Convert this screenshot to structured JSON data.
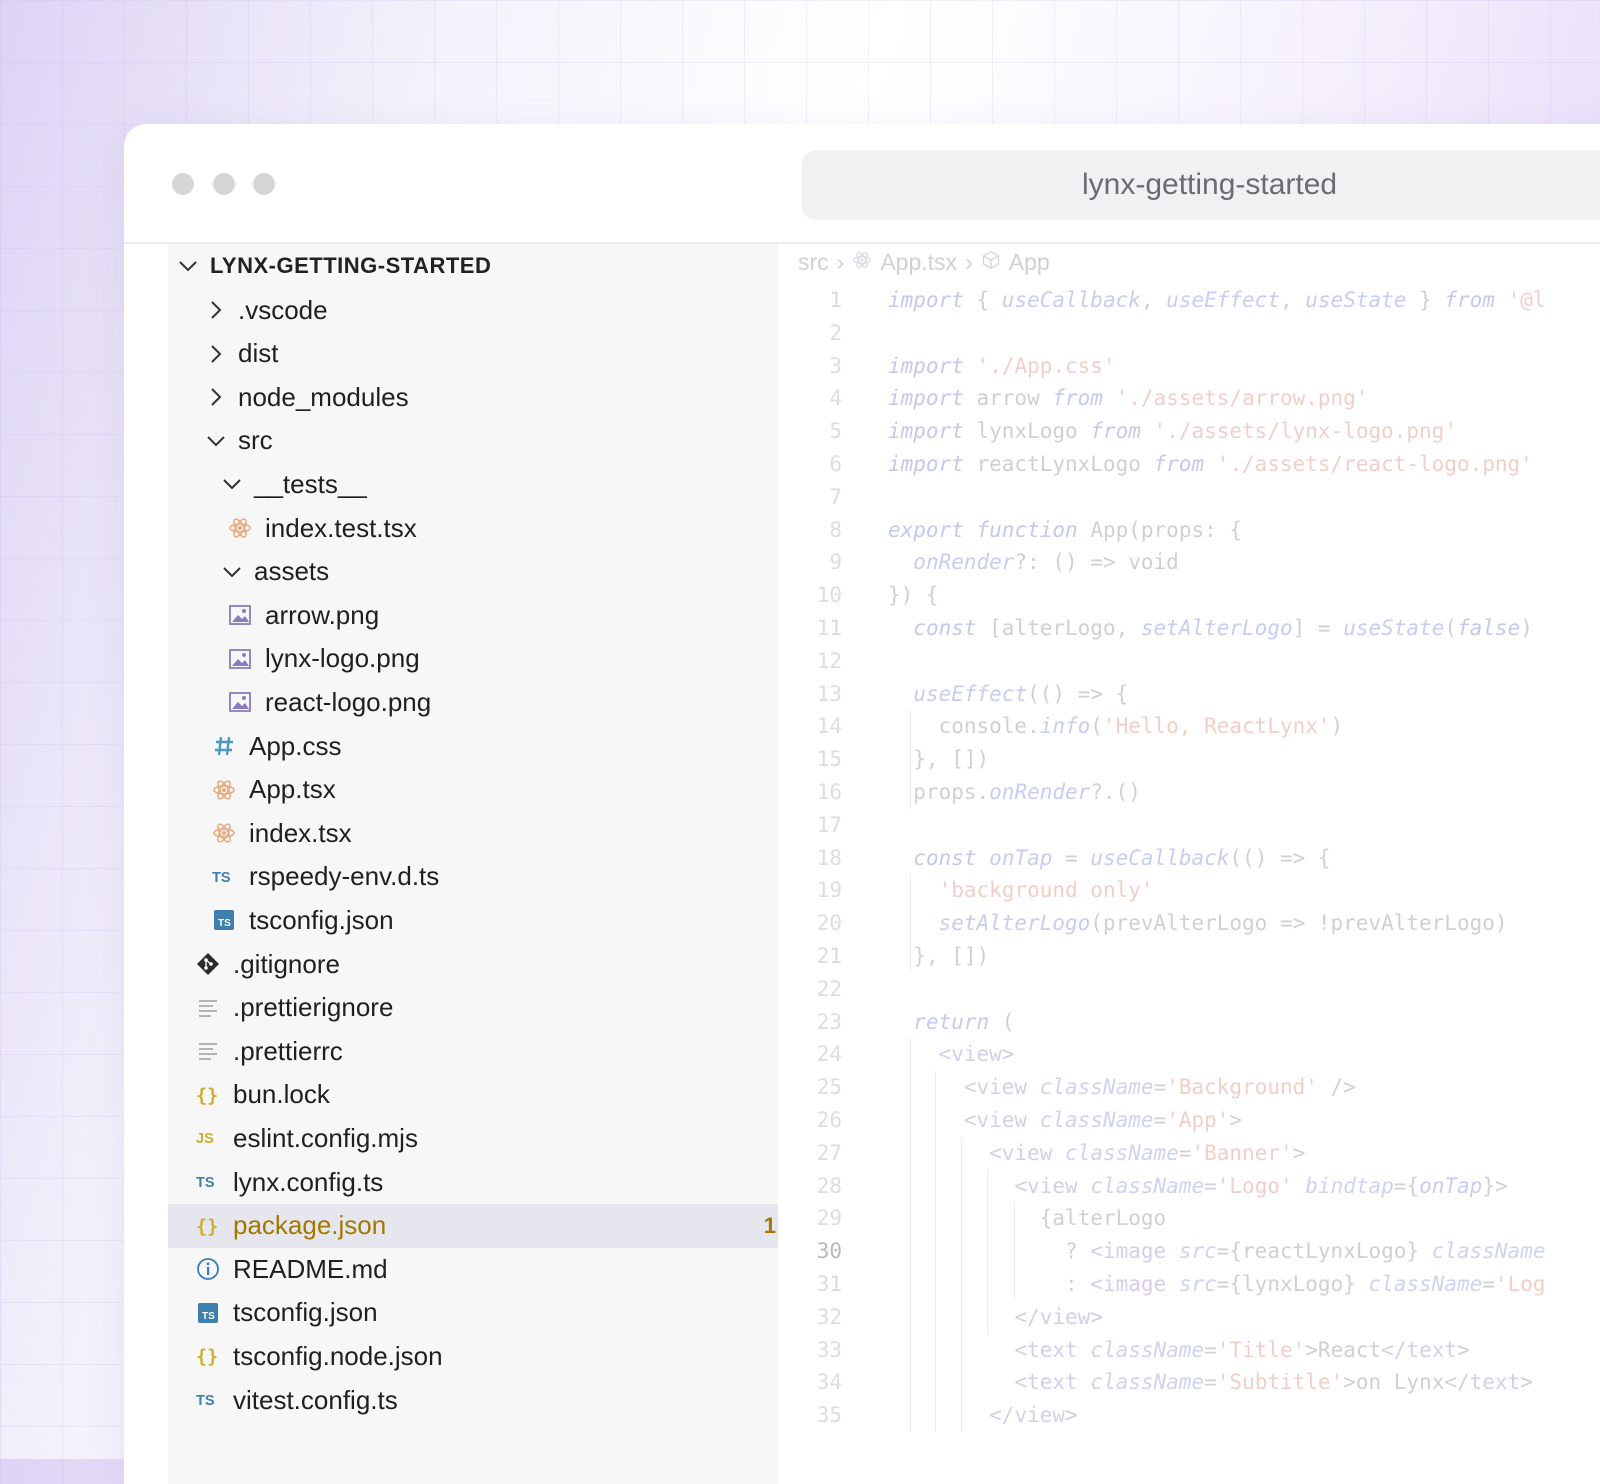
{
  "window": {
    "title": "lynx-getting-started"
  },
  "sidebar": {
    "root_label": "LYNX-GETTING-STARTED",
    "items": [
      {
        "label": ".vscode",
        "icon": "chevron-right-icon",
        "kind": "folder-collapsed"
      },
      {
        "label": "dist",
        "icon": "chevron-right-icon",
        "kind": "folder-collapsed"
      },
      {
        "label": "node_modules",
        "icon": "chevron-right-icon",
        "kind": "folder-collapsed"
      },
      {
        "label": "src",
        "icon": "chevron-down-icon",
        "kind": "folder-open"
      },
      {
        "label": "__tests__",
        "icon": "chevron-down-icon",
        "kind": "folder-open"
      },
      {
        "label": "index.test.tsx",
        "icon": "react-icon",
        "kind": "file"
      },
      {
        "label": "assets",
        "icon": "chevron-down-icon",
        "kind": "folder-open"
      },
      {
        "label": "arrow.png",
        "icon": "image-icon",
        "kind": "file"
      },
      {
        "label": "lynx-logo.png",
        "icon": "image-icon",
        "kind": "file"
      },
      {
        "label": "react-logo.png",
        "icon": "image-icon",
        "kind": "file"
      },
      {
        "label": "App.css",
        "icon": "hash-icon",
        "kind": "file"
      },
      {
        "label": "App.tsx",
        "icon": "react-icon",
        "kind": "file"
      },
      {
        "label": "index.tsx",
        "icon": "react-icon",
        "kind": "file"
      },
      {
        "label": "rspeedy-env.d.ts",
        "icon": "typescript-icon",
        "kind": "file"
      },
      {
        "label": "tsconfig.json",
        "icon": "tsconfig-icon",
        "kind": "file"
      },
      {
        "label": ".gitignore",
        "icon": "git-icon",
        "kind": "file"
      },
      {
        "label": ".prettierignore",
        "icon": "lines-icon",
        "kind": "file"
      },
      {
        "label": ".prettierrc",
        "icon": "lines-icon",
        "kind": "file"
      },
      {
        "label": "bun.lock",
        "icon": "braces-icon",
        "kind": "file"
      },
      {
        "label": "eslint.config.mjs",
        "icon": "javascript-icon",
        "kind": "file"
      },
      {
        "label": "lynx.config.ts",
        "icon": "typescript-icon",
        "kind": "file"
      },
      {
        "label": "package.json",
        "icon": "braces-icon",
        "kind": "file",
        "selected": true,
        "badge": "1"
      },
      {
        "label": "README.md",
        "icon": "info-icon",
        "kind": "file"
      },
      {
        "label": "tsconfig.json",
        "icon": "tsconfig-icon",
        "kind": "file"
      },
      {
        "label": "tsconfig.node.json",
        "icon": "braces-icon",
        "kind": "file"
      },
      {
        "label": "vitest.config.ts",
        "icon": "typescript-icon",
        "kind": "file"
      }
    ]
  },
  "editor": {
    "breadcrumb": [
      "src",
      "App.tsx",
      "App"
    ],
    "active_line": 30,
    "lines": [
      "import { useCallback, useEffect, useState } from '@l",
      "",
      "import './App.css'",
      "import arrow from './assets/arrow.png'",
      "import lynxLogo from './assets/lynx-logo.png'",
      "import reactLynxLogo from './assets/react-logo.png'",
      "",
      "export function App(props: {",
      "  onRender?: () => void",
      "}) {",
      "  const [alterLogo, setAlterLogo] = useState(false)",
      "",
      "  useEffect(() => {",
      "    console.info('Hello, ReactLynx')",
      "  }, [])",
      "  props.onRender?.()",
      "",
      "  const onTap = useCallback(() => {",
      "    'background only'",
      "    setAlterLogo(prevAlterLogo => !prevAlterLogo)",
      "  }, [])",
      "",
      "  return (",
      "    <view>",
      "      <view className='Background' />",
      "      <view className='App'>",
      "        <view className='Banner'>",
      "          <view className='Logo' bindtap={onTap}>",
      "            {alterLogo",
      "              ? <image src={reactLynxLogo} className",
      "              : <image src={lynxLogo} className='Log",
      "          </view>",
      "          <text className='Title'>React</text>",
      "          <text className='Subtitle'>on Lynx</text>",
      "        </view>"
    ]
  },
  "colors": {
    "selected_row_bg": "#e6e6ef",
    "selected_text": "#a37800",
    "react_icon": "#e8a87c",
    "image_icon": "#8a7bc0",
    "css_icon": "#4a9bc0",
    "ts_icon": "#3e7fb0",
    "json_icon": "#c9b12e",
    "js_icon": "#c9b12e"
  }
}
